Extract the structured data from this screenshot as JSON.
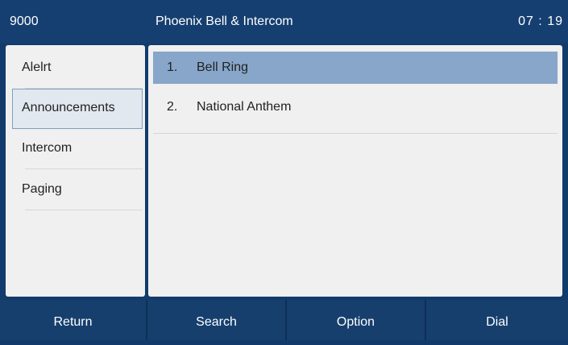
{
  "header": {
    "extension": "9000",
    "title": "Phoenix Bell & Intercom",
    "time": "07 : 19"
  },
  "sidebar": {
    "items": [
      {
        "label": "Alelrt",
        "selected": false
      },
      {
        "label": "Announcements",
        "selected": true
      },
      {
        "label": "Intercom",
        "selected": false
      },
      {
        "label": "Paging",
        "selected": false
      }
    ]
  },
  "list": {
    "items": [
      {
        "number": "1.",
        "label": "Bell Ring",
        "selected": true
      },
      {
        "number": "2.",
        "label": "National Anthem",
        "selected": false
      }
    ]
  },
  "softkeys": {
    "return_label": "Return",
    "search_label": "Search",
    "option_label": "Option",
    "dial_label": "Dial"
  },
  "colors": {
    "header_bg": "#153f70",
    "panel_bg": "#f0f0f0",
    "selected_row": "#87a6c9",
    "selected_menu_border": "#7f9ec1"
  }
}
